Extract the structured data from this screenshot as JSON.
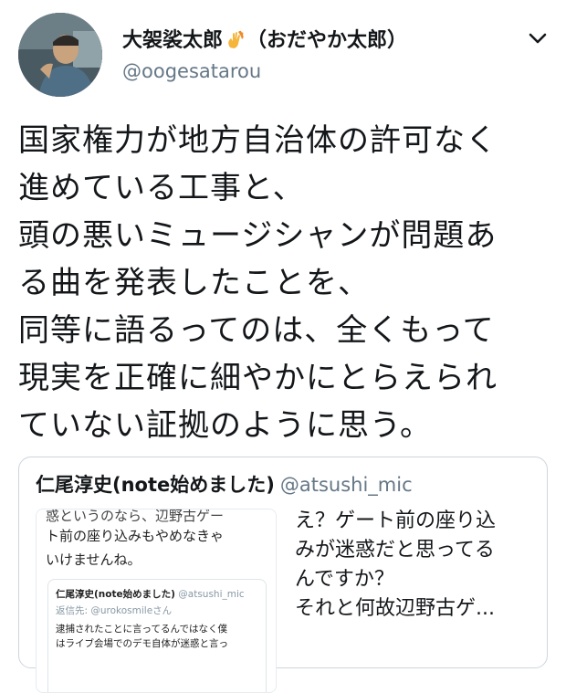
{
  "tweet": {
    "display_name": "大袈裟太郎",
    "display_name_suffix": "（おだやか太郎）",
    "name_emoji_icon": "fire-hand-icon",
    "handle": "@oogesatarou",
    "menu_icon": "chevron-down-icon",
    "text_lines": [
      "国家権力が地方自治体の許可なく",
      "進めている工事と、",
      "頭の悪いミュージシャンが問題あ",
      "る曲を発表したことを、",
      "同等に語るってのは、全くもって",
      "現実を正確に細やかにとらえられ",
      "ていない証拠のように思う。"
    ]
  },
  "quoted_tweet": {
    "display_name": "仁尾淳史(note始めました)",
    "handle": "@atsushi_mic",
    "image": {
      "cut_line": "惑というのなら、辺野古ゲー",
      "lines": [
        "ト前の座り込みもやめなきゃ",
        "いけませんね。"
      ],
      "inner": {
        "name": "仁尾淳史(note始めました)",
        "handle": "@atsushi_mic",
        "reply_prefix": "返信先:",
        "reply_to": "@urokosmileさん",
        "body_lines": [
          "逮捕されたことに言ってるんではなく僕",
          "はライブ会場でのデモ自体が迷惑と言っ"
        ]
      }
    },
    "text_lines": [
      "え？ゲート前の座り込",
      "みが迷惑だと思ってる",
      "んですか？",
      "それと何故辺野古ゲ..."
    ]
  },
  "colors": {
    "text": "#14171a",
    "secondary": "#657786",
    "border": "#ccd6dd"
  }
}
